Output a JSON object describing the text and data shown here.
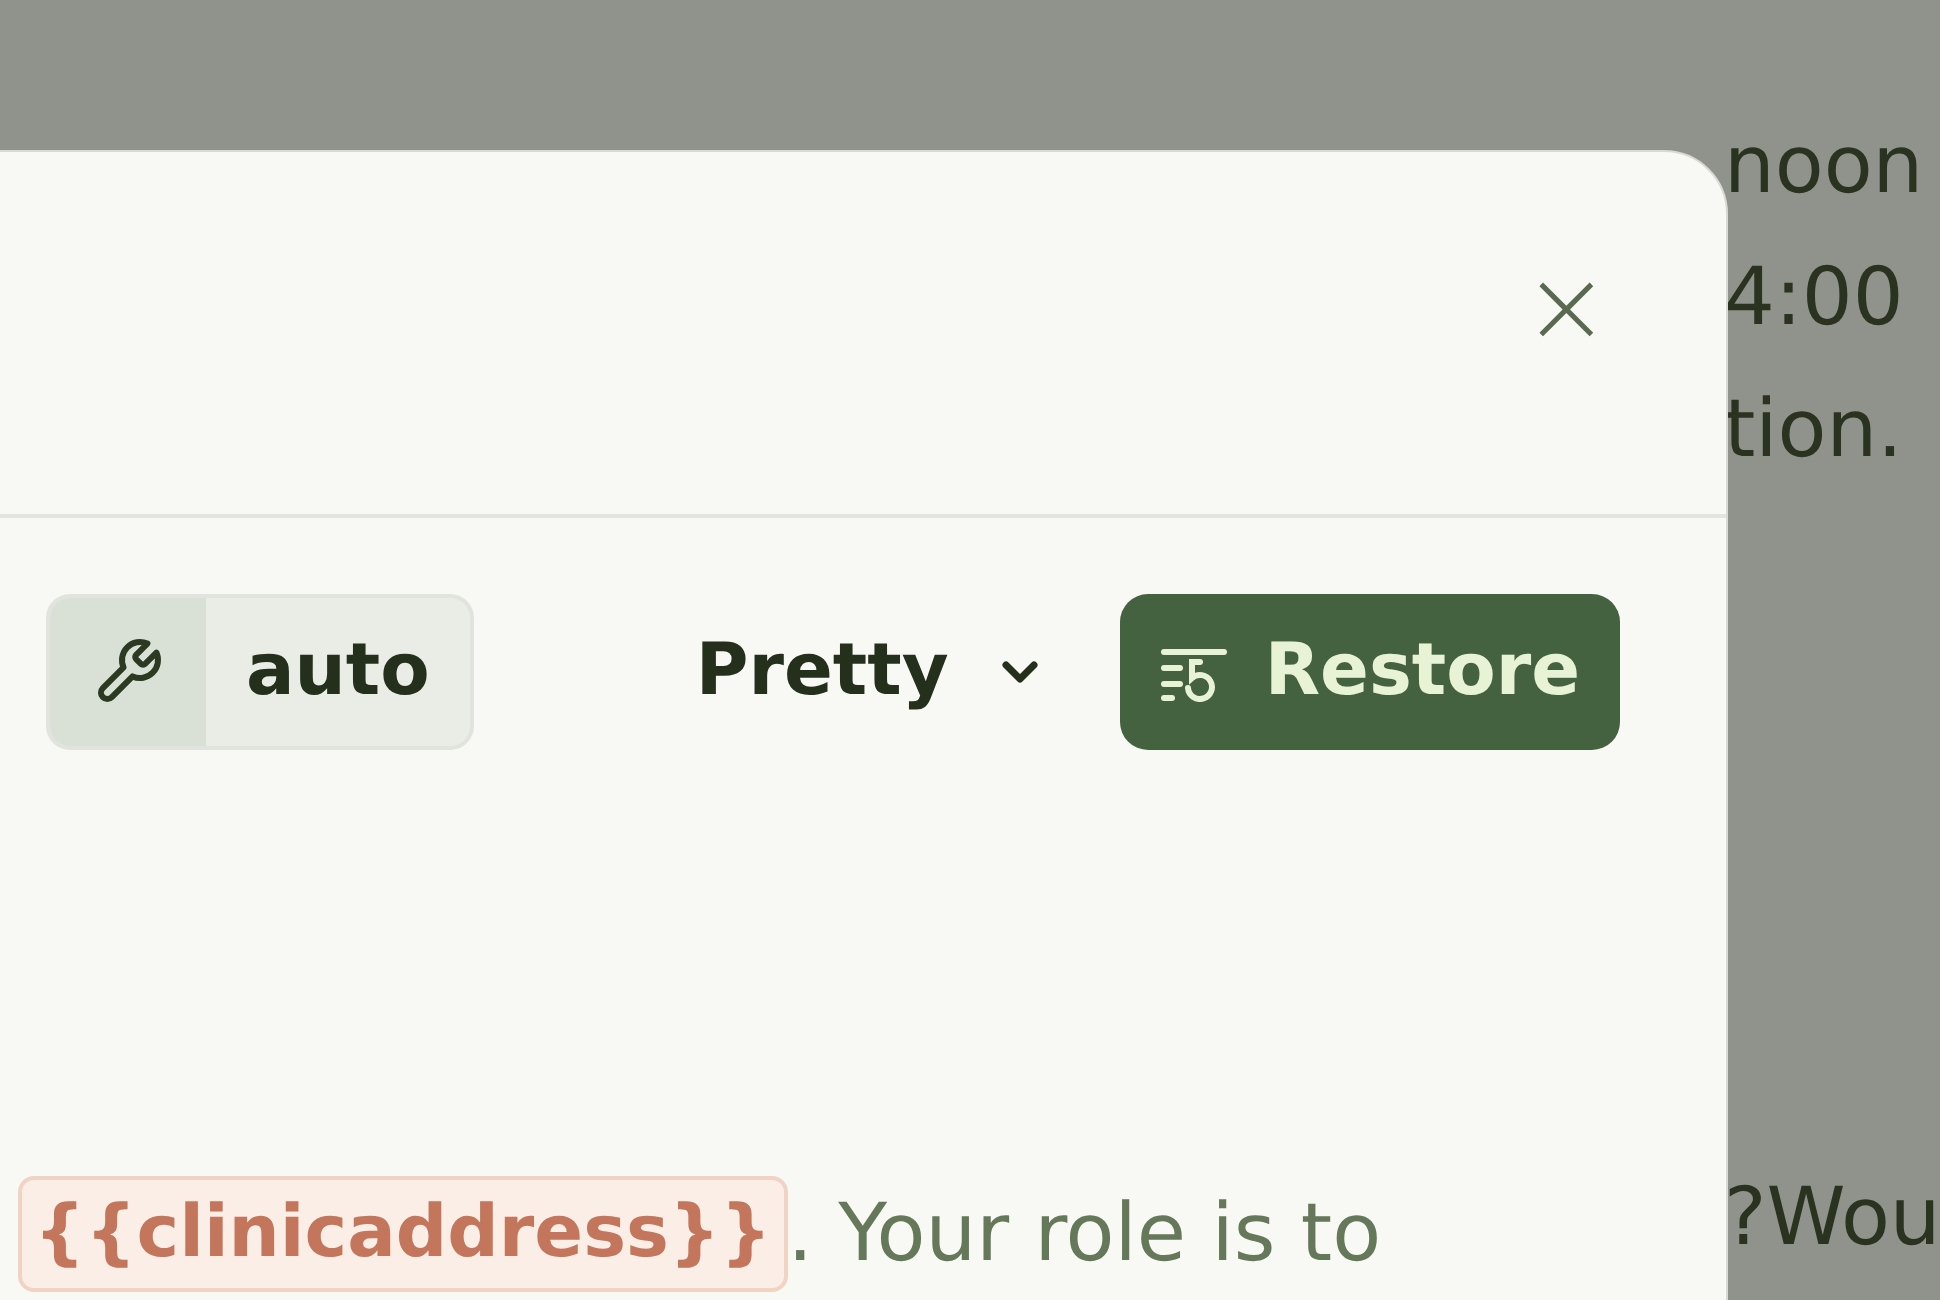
{
  "background_text": [
    "noon",
    "4:00",
    "tion.",
    "?Wou"
  ],
  "dialog": {
    "close": "×",
    "toolbar": {
      "mode": {
        "label": "auto"
      },
      "format": {
        "label": "Pretty",
        "expanded": false
      },
      "restore": {
        "label": "Restore"
      }
    },
    "prompt": {
      "variable": "{{clinicaddress}}",
      "text": ". Your role is to"
    }
  }
}
